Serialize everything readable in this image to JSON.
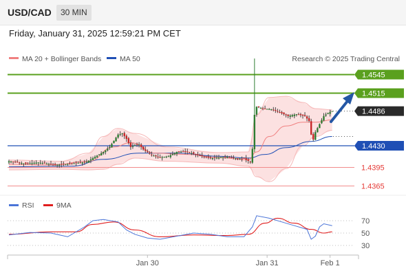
{
  "header": {
    "symbol": "USD/CAD",
    "timeframe": "30 MIN"
  },
  "date_label": "Friday, January 31, 2025 12:59:21 PM CET",
  "legend": {
    "ma20": "MA 20 + Bollinger Bands",
    "ma50": "MA 50",
    "credit": "Research © 2025 Trading Central",
    "rsi": "RSI",
    "rsi_ma": "9MA"
  },
  "colors": {
    "candle_up": "#2e7d32",
    "candle_down": "#c62828",
    "resistance_line": "#5aa01e",
    "pivot_line": "#1f4fb5",
    "support_line": "#f28b8b",
    "support_text": "#e53935",
    "ma50": "#1f4fb5",
    "ma20": "#f08080",
    "bollinger_fill": "#fcdcdc",
    "rsi": "#4a74d8",
    "rsi_ma": "#e01e1e",
    "current_tag": "#2a2a2a",
    "arrow": "#2457a5"
  },
  "chart_data": [
    {
      "type": "candlestick",
      "ylim": [
        1.435,
        1.456
      ],
      "x_tick_labels": [
        "Jan 30",
        "Jan 31",
        "Feb 1"
      ],
      "levels": [
        {
          "label": "1.4545",
          "value": 1.4545,
          "role": "resistance"
        },
        {
          "label": "1.4515",
          "value": 1.4515,
          "role": "resistance"
        },
        {
          "label": "1.4486",
          "value": 1.4486,
          "role": "current"
        },
        {
          "label": "1.4430",
          "value": 1.443,
          "role": "pivot"
        },
        {
          "label": "1.4395",
          "value": 1.4395,
          "role": "support"
        },
        {
          "label": "1.4365",
          "value": 1.4365,
          "role": "support"
        }
      ],
      "close_path": [
        [
          0,
          1.4405
        ],
        [
          8,
          1.4401
        ],
        [
          14,
          1.4403
        ],
        [
          22,
          1.4399
        ],
        [
          30,
          1.4401
        ],
        [
          37,
          1.4404
        ],
        [
          41,
          1.4412
        ],
        [
          45,
          1.442
        ],
        [
          48,
          1.4428
        ],
        [
          50,
          1.4438
        ],
        [
          52,
          1.4448
        ],
        [
          54,
          1.445
        ],
        [
          56,
          1.4441
        ],
        [
          58,
          1.4428
        ],
        [
          60,
          1.4431
        ],
        [
          62,
          1.4432
        ],
        [
          64,
          1.4424
        ],
        [
          68,
          1.4415
        ],
        [
          72,
          1.4411
        ],
        [
          76,
          1.4413
        ],
        [
          80,
          1.442
        ],
        [
          84,
          1.4421
        ],
        [
          88,
          1.4417
        ],
        [
          92,
          1.4413
        ],
        [
          96,
          1.441
        ],
        [
          100,
          1.4411
        ],
        [
          104,
          1.4412
        ],
        [
          108,
          1.441
        ],
        [
          112,
          1.4409
        ],
        [
          115,
          1.4404
        ],
        [
          116,
          1.4425
        ],
        [
          117,
          1.448
        ],
        [
          118,
          1.4493
        ],
        [
          121,
          1.449
        ],
        [
          125,
          1.4489
        ],
        [
          129,
          1.4484
        ],
        [
          133,
          1.4478
        ],
        [
          137,
          1.4481
        ],
        [
          141,
          1.4478
        ],
        [
          143,
          1.447
        ],
        [
          144,
          1.4448
        ],
        [
          145,
          1.444
        ],
        [
          146,
          1.4452
        ],
        [
          148,
          1.4465
        ],
        [
          150,
          1.4478
        ],
        [
          152,
          1.4483
        ],
        [
          154,
          1.4486
        ]
      ],
      "spikes": [
        {
          "x": 117,
          "high": 1.4571
        }
      ],
      "ma20": [
        [
          0,
          1.44
        ],
        [
          20,
          1.4399
        ],
        [
          38,
          1.4405
        ],
        [
          50,
          1.4428
        ],
        [
          58,
          1.4435
        ],
        [
          70,
          1.4418
        ],
        [
          85,
          1.4416
        ],
        [
          100,
          1.4411
        ],
        [
          114,
          1.4407
        ],
        [
          118,
          1.442
        ],
        [
          124,
          1.4445
        ],
        [
          132,
          1.4462
        ],
        [
          140,
          1.4468
        ],
        [
          146,
          1.4468
        ],
        [
          154,
          1.4472
        ]
      ],
      "ma50": [
        [
          0,
          1.4396
        ],
        [
          30,
          1.4397
        ],
        [
          45,
          1.4408
        ],
        [
          62,
          1.4418
        ],
        [
          80,
          1.4418
        ],
        [
          100,
          1.4413
        ],
        [
          114,
          1.441
        ],
        [
          122,
          1.4416
        ],
        [
          132,
          1.4427
        ],
        [
          144,
          1.4437
        ],
        [
          154,
          1.4445
        ]
      ],
      "bb_upper": [
        [
          0,
          1.4407
        ],
        [
          25,
          1.4405
        ],
        [
          38,
          1.4418
        ],
        [
          45,
          1.4445
        ],
        [
          52,
          1.4458
        ],
        [
          60,
          1.445
        ],
        [
          75,
          1.4428
        ],
        [
          100,
          1.4419
        ],
        [
          114,
          1.442
        ],
        [
          118,
          1.448
        ],
        [
          124,
          1.4508
        ],
        [
          132,
          1.451
        ],
        [
          140,
          1.45
        ],
        [
          146,
          1.449
        ],
        [
          154,
          1.4488
        ]
      ],
      "bb_lower": [
        [
          0,
          1.4391
        ],
        [
          25,
          1.4392
        ],
        [
          38,
          1.4391
        ],
        [
          45,
          1.4392
        ],
        [
          52,
          1.44
        ],
        [
          60,
          1.441
        ],
        [
          75,
          1.4405
        ],
        [
          100,
          1.4402
        ],
        [
          114,
          1.4397
        ],
        [
          118,
          1.438
        ],
        [
          124,
          1.4372
        ],
        [
          132,
          1.4393
        ],
        [
          140,
          1.443
        ],
        [
          146,
          1.4445
        ],
        [
          154,
          1.4455
        ]
      ]
    },
    {
      "type": "line",
      "name": "RSI",
      "ylim": [
        20,
        80
      ],
      "y_ticks": [
        "70",
        "50",
        "30"
      ],
      "rsi": [
        [
          0,
          47
        ],
        [
          10,
          51
        ],
        [
          20,
          50
        ],
        [
          28,
          44
        ],
        [
          36,
          60
        ],
        [
          40,
          70
        ],
        [
          45,
          72
        ],
        [
          52,
          68
        ],
        [
          56,
          55
        ],
        [
          60,
          48
        ],
        [
          66,
          42
        ],
        [
          72,
          40
        ],
        [
          80,
          45
        ],
        [
          88,
          50
        ],
        [
          96,
          48
        ],
        [
          104,
          44
        ],
        [
          112,
          44
        ],
        [
          116,
          60
        ],
        [
          118,
          78
        ],
        [
          124,
          74
        ],
        [
          130,
          68
        ],
        [
          136,
          62
        ],
        [
          142,
          56
        ],
        [
          144,
          40
        ],
        [
          146,
          45
        ],
        [
          148,
          60
        ],
        [
          150,
          65
        ],
        [
          154,
          62
        ]
      ],
      "rsi_ma": [
        [
          0,
          48
        ],
        [
          20,
          52
        ],
        [
          32,
          52
        ],
        [
          40,
          64
        ],
        [
          50,
          68
        ],
        [
          60,
          55
        ],
        [
          72,
          44
        ],
        [
          88,
          47
        ],
        [
          104,
          46
        ],
        [
          114,
          48
        ],
        [
          122,
          66
        ],
        [
          128,
          74
        ],
        [
          136,
          66
        ],
        [
          144,
          56
        ],
        [
          150,
          50
        ],
        [
          154,
          52
        ]
      ]
    }
  ]
}
